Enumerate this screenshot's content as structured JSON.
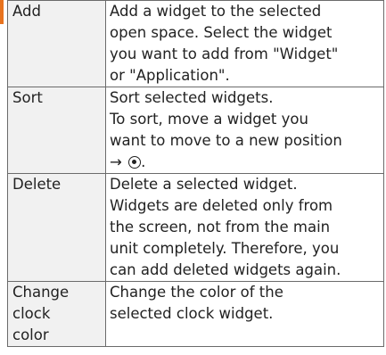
{
  "colors": {
    "accent": "#e8731e",
    "label_bg": "#f1f1f1",
    "border": "#6b6b6b"
  },
  "rows": [
    {
      "action": [
        "Add"
      ],
      "desc": [
        "Add a widget to the selected",
        "open space. Select the widget",
        "you want to add from \"Widget\"",
        "or \"Application\"."
      ]
    },
    {
      "action": [
        "Sort"
      ],
      "desc": [
        "Sort selected widgets.",
        "To sort, move a widget you",
        "want to move to a new position",
        "→"
      ],
      "desc_end": ".",
      "icon": "radio-button-icon"
    },
    {
      "action": [
        "Delete"
      ],
      "desc": [
        "Delete a selected widget.",
        "Widgets are deleted only from",
        "the screen, not from the main",
        "unit completely. Therefore, you",
        "can add deleted widgets again."
      ]
    },
    {
      "action": [
        "Change",
        "clock",
        "color"
      ],
      "desc": [
        "Change the color of the",
        "selected clock widget."
      ]
    }
  ]
}
